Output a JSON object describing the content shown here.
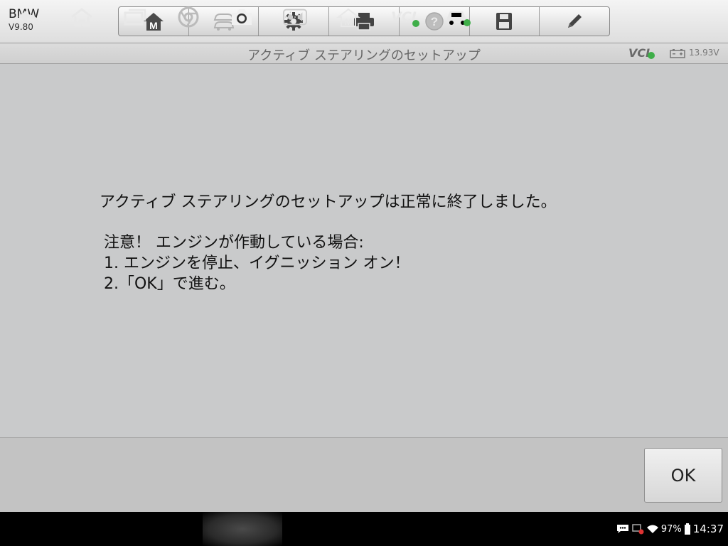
{
  "header": {
    "make": "BMW",
    "version": "V9.80"
  },
  "toolbar": {
    "buttons": [
      {
        "icon": "home-m-icon"
      },
      {
        "icon": "vehicle-swap-icon",
        "disabled": true
      },
      {
        "icon": "gear-icon"
      },
      {
        "icon": "printer-icon"
      },
      {
        "icon": "help-icon",
        "disabled": true
      },
      {
        "icon": "save-icon"
      },
      {
        "icon": "pencil-icon"
      }
    ]
  },
  "titlebar": {
    "title": "アクティブ ステアリングのセットアップ",
    "vci": "VCI",
    "voltage": "13.93V"
  },
  "message": {
    "line1": "アクティブ ステアリングのセットアップは正常に終了しました。",
    "line2": "注意！ エンジンが作動している場合:",
    "line3": "1. エンジンを停止、イグニッション オン！",
    "line4": "2.「OK」で進む。"
  },
  "actions": {
    "ok_label": "OK"
  },
  "navbar": {
    "vci": "VCI",
    "icons": [
      "back-icon",
      "home-icon",
      "recent-apps-icon",
      "chrome-icon",
      "camera-icon",
      "brightness-volume-icon",
      "autel-home-icon",
      "vci-icon",
      "car-icon"
    ]
  },
  "statusbar": {
    "battery": "97%",
    "time": "14:37"
  },
  "colors": {
    "vci_green": "#3fae49",
    "background": "#c9cacb"
  }
}
